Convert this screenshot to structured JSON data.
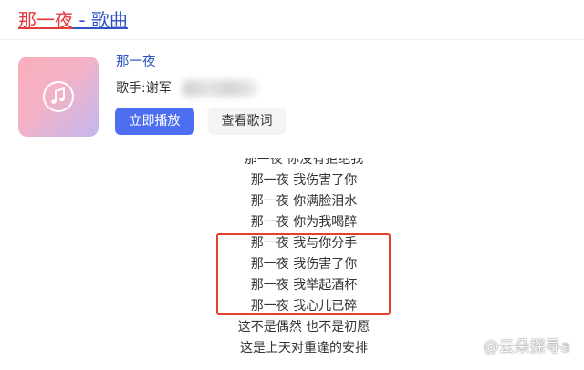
{
  "header": {
    "title_keyword": "那一夜",
    "title_suffix": " - 歌曲"
  },
  "song": {
    "cover_icon": "music-note-icon",
    "name": "那一夜",
    "singer": "歌手:谢军"
  },
  "actions": {
    "play_label": "立即播放",
    "lyrics_label": "查看歌词"
  },
  "lyrics": {
    "lines": [
      "那一夜 你没有拒绝我",
      "那一夜 我伤害了你",
      "那一夜 你满脸泪水",
      "那一夜 你为我喝醉",
      "那一夜 我与你分手",
      "那一夜 我伤害了你",
      "那一夜 我举起酒杯",
      "那一夜 我心儿已碎",
      "这不是偶然 也不是初愿",
      "这是上天对重逢的安排"
    ],
    "highlight": {
      "first_line": 4,
      "last_line": 7
    }
  },
  "watermark": {
    "text": "@云朵探寻a"
  },
  "colors": {
    "keyword": "#e5393c",
    "link": "#2f54c4",
    "primary_button": "#4e6ef2",
    "highlight_box": "#e3402e"
  }
}
